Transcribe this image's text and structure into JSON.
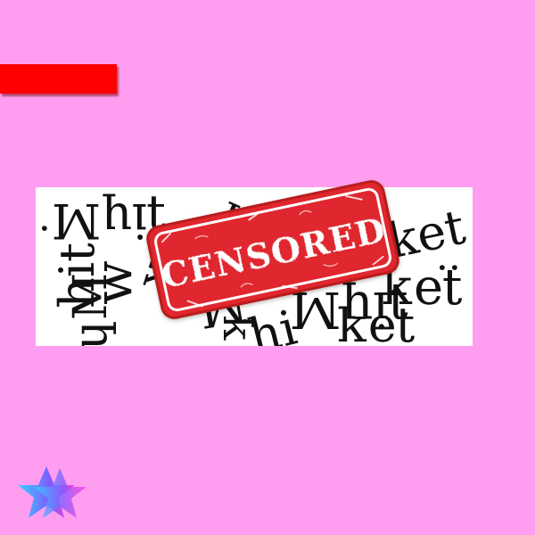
{
  "colors": {
    "background": "#ff9ef0",
    "bar": "#ff0000",
    "stamp_red": "#e0262e",
    "stamp_dark": "#b91c1c",
    "text_dark": "#111111",
    "star_left": "#34d2ff",
    "star_mid": "#7f5cff",
    "star_right": "#ff3ddf"
  },
  "stamp": {
    "text": "CENSORED"
  },
  "icons": {
    "star": "star-icon"
  }
}
